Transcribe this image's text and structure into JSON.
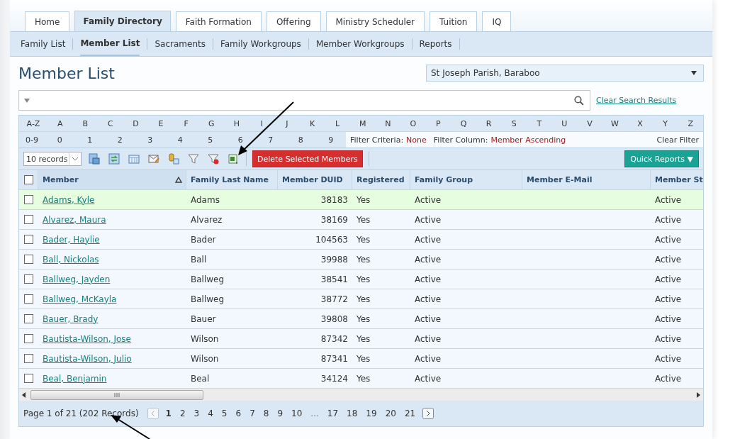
{
  "tabs": [
    {
      "label": "Home",
      "selected": false
    },
    {
      "label": "Family Directory",
      "selected": true
    },
    {
      "label": "Faith Formation",
      "selected": false
    },
    {
      "label": "Offering",
      "selected": false
    },
    {
      "label": "Ministry Scheduler",
      "selected": false
    },
    {
      "label": "Tuition",
      "selected": false
    },
    {
      "label": "IQ",
      "selected": false
    }
  ],
  "subnav": [
    {
      "label": "Family List",
      "selected": false
    },
    {
      "label": "Member List",
      "selected": true
    },
    {
      "label": "Sacraments",
      "selected": false
    },
    {
      "label": "Family Workgroups",
      "selected": false
    },
    {
      "label": "Member Workgroups",
      "selected": false
    },
    {
      "label": "Reports",
      "selected": false
    }
  ],
  "page_title": "Member List",
  "parish_select": {
    "value": "St Joseph Parish, Baraboo"
  },
  "clear_search": "Clear Search Results",
  "letters": [
    "A-Z",
    "A",
    "B",
    "C",
    "D",
    "E",
    "F",
    "G",
    "H",
    "I",
    "J",
    "K",
    "L",
    "M",
    "N",
    "O",
    "P",
    "Q",
    "R",
    "S",
    "T",
    "U",
    "V",
    "W",
    "X",
    "Y",
    "Z"
  ],
  "digits": [
    "0-9",
    "0",
    "1",
    "2",
    "3",
    "4",
    "5",
    "6",
    "7",
    "8",
    "9"
  ],
  "filter": {
    "criteria_label": "Filter Criteria:",
    "criteria_value": "None",
    "column_label": "Filter Column:",
    "column_value": "Member Ascending",
    "clear": "Clear Filter"
  },
  "toolbar": {
    "records": "10 records",
    "delete": "Delete Selected Members",
    "quick_reports": "Quick Reports ▼"
  },
  "table": {
    "select_all_checked": false,
    "columns": [
      {
        "label": "Member",
        "sorted": true
      },
      {
        "label": "Family Last Name",
        "sorted": false
      },
      {
        "label": "Member DUID",
        "sorted": false
      },
      {
        "label": "Registered",
        "sorted": false
      },
      {
        "label": "Family Group",
        "sorted": false
      },
      {
        "label": "Member E-Mail",
        "sorted": false
      },
      {
        "label": "Member St",
        "sorted": false
      }
    ],
    "rows": [
      {
        "member": "Adams, Kyle",
        "family": "Adams",
        "duid": "38183",
        "registered": "Yes",
        "group": "Active",
        "status": "Active",
        "highlighted": true,
        "checked": false
      },
      {
        "member": "Alvarez, Maura",
        "family": "Alvarez",
        "duid": "38169",
        "registered": "Yes",
        "group": "Active",
        "status": "Active",
        "highlighted": false,
        "checked": false
      },
      {
        "member": "Bader, Haylie",
        "family": "Bader",
        "duid": "104563",
        "registered": "Yes",
        "group": "Active",
        "status": "Active",
        "highlighted": false,
        "checked": false
      },
      {
        "member": "Ball, Nickolas",
        "family": "Ball",
        "duid": "39988",
        "registered": "Yes",
        "group": "Active",
        "status": "Active",
        "highlighted": false,
        "checked": false
      },
      {
        "member": "Ballweg, Jayden",
        "family": "Ballweg",
        "duid": "38541",
        "registered": "Yes",
        "group": "Active",
        "status": "Active",
        "highlighted": false,
        "checked": false
      },
      {
        "member": "Ballweg, McKayla",
        "family": "Ballweg",
        "duid": "38772",
        "registered": "Yes",
        "group": "Active",
        "status": "Active",
        "highlighted": false,
        "checked": false
      },
      {
        "member": "Bauer, Brady",
        "family": "Bauer",
        "duid": "39808",
        "registered": "Yes",
        "group": "Active",
        "status": "Active",
        "highlighted": false,
        "checked": false
      },
      {
        "member": "Bautista-Wilson, Jose",
        "family": "Wilson",
        "duid": "87342",
        "registered": "Yes",
        "group": "Active",
        "status": "Active",
        "highlighted": false,
        "checked": false
      },
      {
        "member": "Bautista-Wilson, Julio",
        "family": "Wilson",
        "duid": "87341",
        "registered": "Yes",
        "group": "Active",
        "status": "Active",
        "highlighted": false,
        "checked": false
      },
      {
        "member": "Beal, Benjamin",
        "family": "Beal",
        "duid": "34124",
        "registered": "Yes",
        "group": "Active",
        "status": "Active",
        "highlighted": false,
        "checked": false
      }
    ]
  },
  "pager": {
    "summary": "Page 1 of 21 (202 Records)",
    "pages": [
      {
        "label": "1",
        "kind": "page",
        "selected": true
      },
      {
        "label": "2",
        "kind": "page",
        "selected": false
      },
      {
        "label": "3",
        "kind": "page",
        "selected": false
      },
      {
        "label": "4",
        "kind": "page",
        "selected": false
      },
      {
        "label": "5",
        "kind": "page",
        "selected": false
      },
      {
        "label": "6",
        "kind": "page",
        "selected": false
      },
      {
        "label": "7",
        "kind": "page",
        "selected": false
      },
      {
        "label": "8",
        "kind": "page",
        "selected": false
      },
      {
        "label": "9",
        "kind": "page",
        "selected": false
      },
      {
        "label": "10",
        "kind": "page",
        "selected": false
      },
      {
        "label": "...",
        "kind": "gap"
      },
      {
        "label": "17",
        "kind": "page",
        "selected": false
      },
      {
        "label": "18",
        "kind": "page",
        "selected": false
      },
      {
        "label": "19",
        "kind": "page",
        "selected": false
      },
      {
        "label": "20",
        "kind": "page",
        "selected": false
      },
      {
        "label": "21",
        "kind": "page",
        "selected": false
      }
    ]
  }
}
